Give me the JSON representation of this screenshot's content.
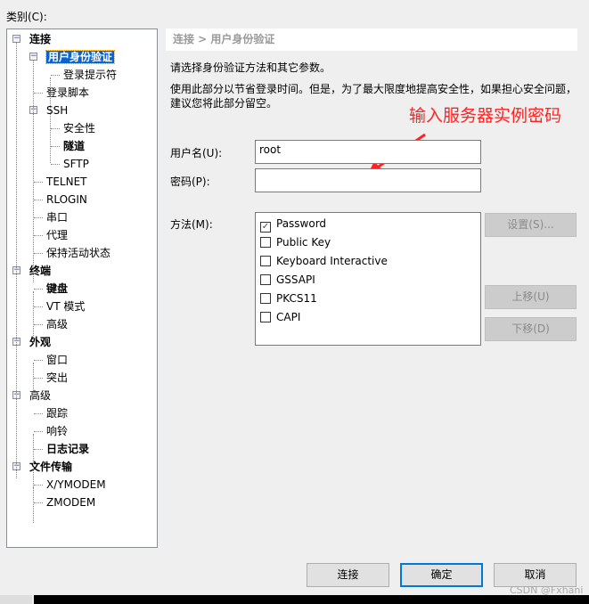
{
  "category_label": "类别(C):",
  "tree": [
    {
      "label": "连接",
      "level": 0,
      "bold": true,
      "expander": true
    },
    {
      "label": "用户身份验证",
      "level": 1,
      "bold": true,
      "expander": true,
      "selected": true
    },
    {
      "label": "登录提示符",
      "level": 2
    },
    {
      "label": "登录脚本",
      "level": 1
    },
    {
      "label": "SSH",
      "level": 1,
      "expander": true
    },
    {
      "label": "安全性",
      "level": 2
    },
    {
      "label": "隧道",
      "level": 2,
      "bold": true
    },
    {
      "label": "SFTP",
      "level": 2
    },
    {
      "label": "TELNET",
      "level": 1
    },
    {
      "label": "RLOGIN",
      "level": 1
    },
    {
      "label": "串口",
      "level": 1
    },
    {
      "label": "代理",
      "level": 1
    },
    {
      "label": "保持活动状态",
      "level": 1
    },
    {
      "label": "终端",
      "level": 0,
      "bold": true,
      "expander": true
    },
    {
      "label": "键盘",
      "level": 1,
      "bold": true
    },
    {
      "label": "VT 模式",
      "level": 1
    },
    {
      "label": "高级",
      "level": 1
    },
    {
      "label": "外观",
      "level": 0,
      "bold": true,
      "expander": true
    },
    {
      "label": "窗口",
      "level": 1
    },
    {
      "label": "突出",
      "level": 1
    },
    {
      "label": "高级",
      "level": 0,
      "expander": true
    },
    {
      "label": "跟踪",
      "level": 1
    },
    {
      "label": "响铃",
      "level": 1
    },
    {
      "label": "日志记录",
      "level": 1,
      "bold": true
    },
    {
      "label": "文件传输",
      "level": 0,
      "bold": true,
      "expander": true
    },
    {
      "label": "X/YMODEM",
      "level": 1
    },
    {
      "label": "ZMODEM",
      "level": 1
    }
  ],
  "breadcrumb": "连接 > 用户身份验证",
  "intro": "请选择身份验证方法和其它参数。",
  "desc1": "使用此部分以节省登录时间。但是，为了最大限度地提高安全性，如果担心安全问题，",
  "desc2": "建议您将此部分留空。",
  "annotation": "输入服务器实例密码",
  "annotation_color": "#ff2222",
  "username_label": "用户名(U):",
  "username_value": "root",
  "password_label": "密码(P):",
  "password_value": "",
  "method_label": "方法(M):",
  "methods": [
    {
      "label": "Password",
      "checked": true
    },
    {
      "label": "Public Key",
      "checked": false
    },
    {
      "label": "Keyboard Interactive",
      "checked": false
    },
    {
      "label": "GSSAPI",
      "checked": false
    },
    {
      "label": "PKCS11",
      "checked": false
    },
    {
      "label": "CAPI",
      "checked": false
    }
  ],
  "settings_button": "设置(S)...",
  "up_button": "上移(U)",
  "down_button": "下移(D)",
  "connect_button": "连接",
  "ok_button": "确定",
  "cancel_button": "取消",
  "watermark": "CSDN @Fxhani"
}
